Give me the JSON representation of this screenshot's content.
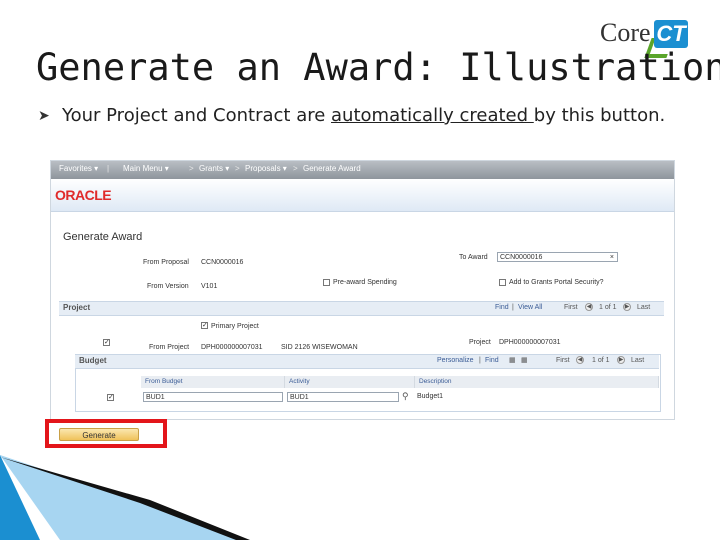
{
  "slide": {
    "title": "Generate an Award: Illustration",
    "bullet_before": "Your Project and Contract are ",
    "bullet_underlined": "automatically created ",
    "bullet_after": "by this button.",
    "logo_core": "Core",
    "logo_ct": "CT"
  },
  "app": {
    "nav": {
      "favorites": "Favorites ▾",
      "main_menu": "Main Menu ▾",
      "grants": "Grants ▾",
      "proposals": "Proposals ▾",
      "generate_award": "Generate Award"
    },
    "brand": "ORACLE",
    "page_title": "Generate Award",
    "from_proposal_label": "From Proposal",
    "from_proposal_value": "CCN0000016",
    "to_award_label": "To Award",
    "to_award_value": "CCN0000016",
    "from_version_label": "From Version",
    "from_version_value": "V101",
    "pre_award_label": "Pre-award Spending",
    "add_to_grants_label": "Add to Grants Portal Security?",
    "project_section": {
      "title": "Project",
      "find": "Find",
      "view_all": "View All",
      "first": "First",
      "pager": "1 of 1",
      "last": "Last",
      "primary_project_label": "Primary Project",
      "project_label": "Project",
      "project_value": "DPH000000007031",
      "from_project_label": "From Project",
      "from_project_value": "DPH000000007031",
      "from_project_desc": "SID 2126 WISEWOMAN"
    },
    "budget_section": {
      "title": "Budget",
      "personalize": "Personalize",
      "find": "Find",
      "first": "First",
      "pager": "1 of 1",
      "last": "Last",
      "columns": [
        "From Budget",
        "Activity",
        "Description"
      ],
      "row": {
        "from_budget": "BUD1",
        "activity": "BUD1",
        "description": "Budget1"
      }
    },
    "generate_button": "Generate"
  },
  "colors": {
    "highlight": "#e3151a",
    "oracle_red": "#e02a2a",
    "link_blue": "#3b5c96",
    "deco_blue": "#1b8fd1"
  }
}
